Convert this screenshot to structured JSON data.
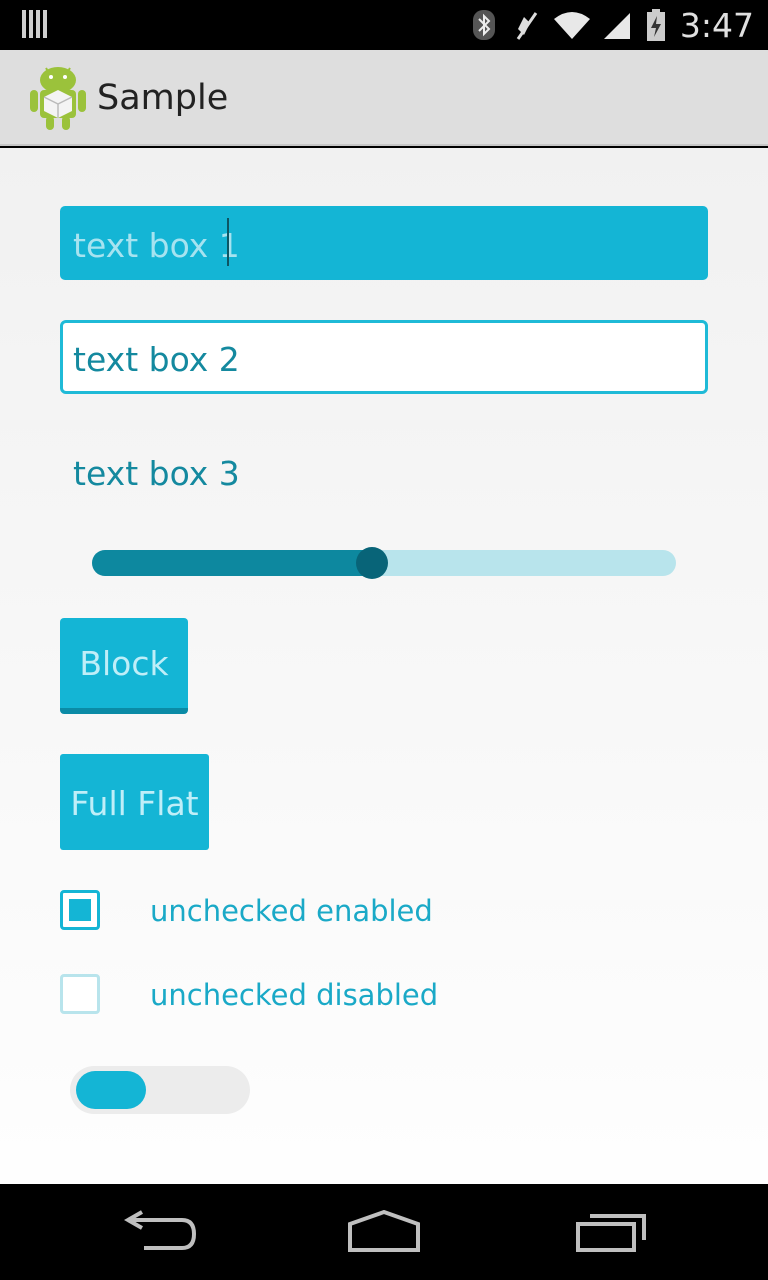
{
  "status_bar": {
    "time": "3:47",
    "icons": [
      "signal-bars-icon",
      "bluetooth-icon",
      "mute-icon",
      "wifi-icon",
      "cell-signal-icon",
      "battery-charging-icon"
    ]
  },
  "action_bar": {
    "app_icon": "android-app-icon",
    "title": "Sample"
  },
  "form": {
    "text_box_1": "text box 1",
    "text_box_2": "text box 2",
    "text_box_3": "text box 3",
    "slider_value": 0.48,
    "block_button_label": "Block",
    "flat_button_label": "Full Flat",
    "checkbox_enabled_label": "unchecked enabled",
    "checkbox_disabled_label": "unchecked disabled",
    "toggle_on": false
  },
  "colors": {
    "accent": "#14b5d5",
    "accent_dark": "#0d889f",
    "accent_light": "#b8e4ec"
  },
  "nav_bar": {
    "icons": [
      "back-icon",
      "home-icon",
      "recents-icon"
    ]
  }
}
